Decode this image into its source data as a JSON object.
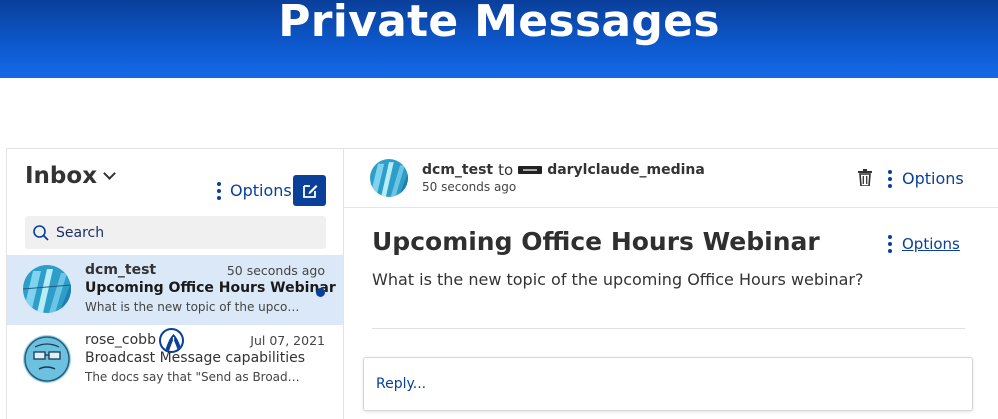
{
  "banner": {
    "title": "Private Messages"
  },
  "sidebar": {
    "title": "Inbox",
    "options_label": "Options",
    "search_placeholder": "Search",
    "messages": [
      {
        "user": "dcm_test",
        "date": "50 seconds ago",
        "subject": "Upcoming Office Hours Webinar",
        "snippet": "What is the new topic of the upcoming Office Hours webinar?",
        "unread": true
      },
      {
        "user": "rose_cobb",
        "date": "Jul 07, 2021",
        "subject": "Broadcast Message capabilities",
        "snippet": "The docs say that \"Send as Broadcast message\" ...",
        "unread": false
      }
    ]
  },
  "thread": {
    "from": "dcm_test",
    "to_word": "to",
    "recipient": "darylclaude_medina",
    "time": "50 seconds ago",
    "options_label": "Options",
    "subject": "Upcoming Office Hours Webinar",
    "subject_options_label": "Options",
    "body": "What is the new topic of the upcoming Office Hours webinar?",
    "reply_label": "Reply..."
  },
  "colors": {
    "brand": "#0a3f9a",
    "active_row": "#dbe8f7"
  },
  "icons": [
    "chevron-down-icon",
    "kebab-icon",
    "compose-icon",
    "search-icon",
    "trash-icon"
  ]
}
